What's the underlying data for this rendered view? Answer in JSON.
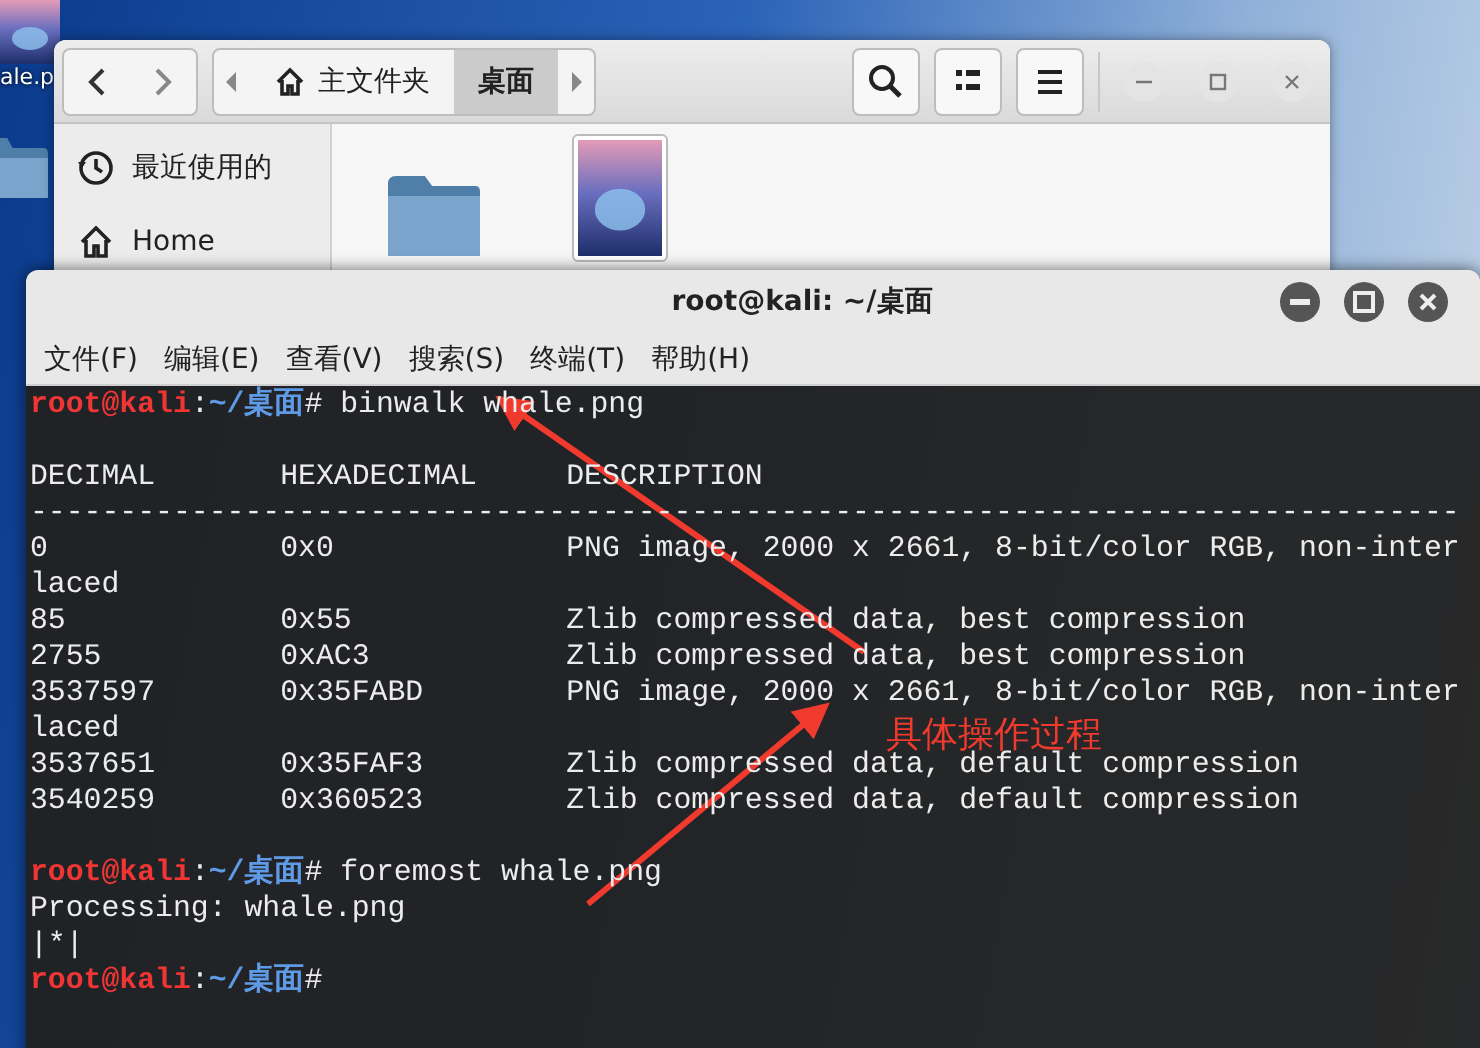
{
  "desktop": {
    "icons": [
      {
        "kind": "image",
        "label": "ale.p"
      },
      {
        "kind": "folder"
      }
    ]
  },
  "file_manager": {
    "path": [
      {
        "kind": "home",
        "label": "主文件夹",
        "selected": false
      },
      {
        "kind": "folder",
        "label": "桌面",
        "selected": true
      }
    ],
    "sidebar": [
      {
        "kind": "recent",
        "label": "最近使用的"
      },
      {
        "kind": "home",
        "label": "Home"
      }
    ],
    "files": [
      {
        "kind": "folder"
      },
      {
        "kind": "image"
      }
    ]
  },
  "terminal": {
    "title": "root@kali: ~/桌面",
    "menu": [
      "文件(F)",
      "编辑(E)",
      "查看(V)",
      "搜索(S)",
      "终端(T)",
      "帮助(H)"
    ],
    "lines": [
      {
        "kind": "prompt",
        "user": "root@kali",
        "separator": ":",
        "path": "~/桌面",
        "symbol": "#",
        "command": "binwalk whale.png"
      },
      {
        "kind": "blank"
      },
      {
        "kind": "output",
        "text": "DECIMAL       HEXADECIMAL     DESCRIPTION"
      },
      {
        "kind": "output",
        "text": "--------------------------------------------------------------------------------"
      },
      {
        "kind": "output",
        "text": "0             0x0             PNG image, 2000 x 2661, 8-bit/color RGB, non-inter"
      },
      {
        "kind": "output",
        "text": "laced"
      },
      {
        "kind": "output",
        "text": "85            0x55            Zlib compressed data, best compression"
      },
      {
        "kind": "output",
        "text": "2755          0xAC3           Zlib compressed data, best compression"
      },
      {
        "kind": "output",
        "text": "3537597       0x35FABD        PNG image, 2000 x 2661, 8-bit/color RGB, non-inter"
      },
      {
        "kind": "output",
        "text": "laced"
      },
      {
        "kind": "output",
        "text": "3537651       0x35FAF3        Zlib compressed data, default compression"
      },
      {
        "kind": "output",
        "text": "3540259       0x360523        Zlib compressed data, default compression"
      },
      {
        "kind": "blank"
      },
      {
        "kind": "prompt",
        "user": "root@kali",
        "separator": ":",
        "path": "~/桌面",
        "symbol": "#",
        "command": "foremost whale.png"
      },
      {
        "kind": "output",
        "text": "Processing: whale.png"
      },
      {
        "kind": "output",
        "text": "|*|"
      },
      {
        "kind": "prompt",
        "user": "root@kali",
        "separator": ":",
        "path": "~/桌面",
        "symbol": "#"
      }
    ]
  },
  "annotation": {
    "text": "具体操作过程"
  }
}
